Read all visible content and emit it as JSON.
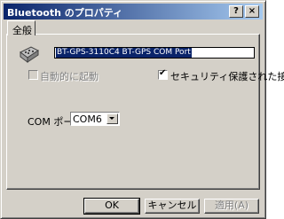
{
  "window": {
    "title": "Bluetooth のプロパティ",
    "help_label": "?",
    "close_label": "×"
  },
  "tabs": [
    {
      "label": "全般"
    }
  ],
  "device": {
    "icon": "serial-port-connector-icon",
    "name": "BT-GPS-3110C4 BT-GPS COM Port"
  },
  "options": {
    "auto_start": {
      "label": "自動的に起動",
      "checked": false,
      "enabled": false
    },
    "secure": {
      "label": "セキュリティ保護された接続",
      "checked": true,
      "enabled": true
    }
  },
  "com_port": {
    "label": "COM ポート",
    "value": "COM6"
  },
  "buttons": {
    "ok": "OK",
    "cancel": "キャンセル",
    "apply": "適用(A)"
  },
  "colors": {
    "titlebar_start": "#0a246a",
    "titlebar_end": "#a6caf0",
    "face": "#d4d0c8",
    "selection": "#0a246a"
  }
}
